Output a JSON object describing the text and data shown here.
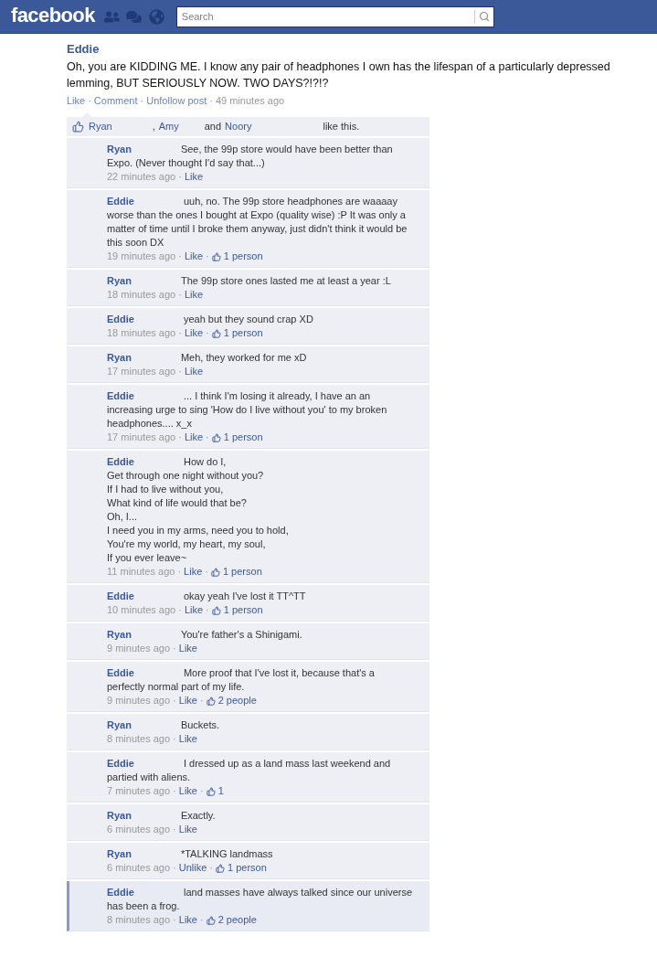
{
  "header": {
    "logo": "facebook",
    "search": {
      "placeholder": "Search"
    }
  },
  "post": {
    "author": "Eddie",
    "message": "Oh, you are KIDDING ME. I know any pair of headphones I own has the lifespan of a particularly depressed lemming, BUT SERIOUSLY NOW. TWO DAYS?!?!?",
    "footer": [
      {
        "kind": "link",
        "text": "Like"
      },
      {
        "kind": "sep",
        "text": "·"
      },
      {
        "kind": "link",
        "text": "Comment"
      },
      {
        "kind": "sep",
        "text": "·"
      },
      {
        "kind": "link",
        "text": "Unfollow post"
      },
      {
        "kind": "sep",
        "text": "·"
      },
      {
        "kind": "time",
        "text": "49 minutes ago"
      }
    ]
  },
  "likes": {
    "parts": [
      {
        "kind": "name",
        "text": "Ryan"
      },
      {
        "kind": "plain",
        "text": ","
      },
      {
        "kind": "name",
        "text": "Amy"
      },
      {
        "kind": "plain",
        "text": "and"
      },
      {
        "kind": "name",
        "text": "Noory"
      },
      {
        "kind": "plain",
        "text": "like this."
      }
    ]
  },
  "comments": [
    {
      "author": "Ryan",
      "text": "See, the 99p store would have been better than Expo. (Never thought I'd say that...)",
      "highlighted": false,
      "footer": [
        {
          "kind": "time",
          "text": "22 minutes ago"
        },
        {
          "kind": "sep",
          "text": "·"
        },
        {
          "kind": "link",
          "text": "Like"
        }
      ]
    },
    {
      "author": "Eddie",
      "text": "uuh, no. The 99p store headphones are waaaay worse than the ones I bought at Expo (quality wise) :P It was only a matter of time until I broke them anyway, just didn't think it would be this soon DX",
      "highlighted": false,
      "footer": [
        {
          "kind": "time",
          "text": "19 minutes ago"
        },
        {
          "kind": "sep",
          "text": "·"
        },
        {
          "kind": "link",
          "text": "Like"
        },
        {
          "kind": "sep",
          "text": "·"
        },
        {
          "kind": "likes",
          "text": "1 person"
        }
      ]
    },
    {
      "author": "Ryan",
      "text": "The 99p store ones lasted me at least a year :L",
      "highlighted": false,
      "footer": [
        {
          "kind": "time",
          "text": "18 minutes ago"
        },
        {
          "kind": "sep",
          "text": "·"
        },
        {
          "kind": "link",
          "text": "Like"
        }
      ]
    },
    {
      "author": "Eddie",
      "text": "yeah but they sound crap XD",
      "highlighted": false,
      "footer": [
        {
          "kind": "time",
          "text": "18 minutes ago"
        },
        {
          "kind": "sep",
          "text": "·"
        },
        {
          "kind": "link",
          "text": "Like"
        },
        {
          "kind": "sep",
          "text": "·"
        },
        {
          "kind": "likes",
          "text": "1 person"
        }
      ]
    },
    {
      "author": "Ryan",
      "text": "Meh, they worked for me xD",
      "highlighted": false,
      "footer": [
        {
          "kind": "time",
          "text": "17 minutes ago"
        },
        {
          "kind": "sep",
          "text": "·"
        },
        {
          "kind": "link",
          "text": "Like"
        }
      ]
    },
    {
      "author": "Eddie",
      "text": "... I think I'm losing it already, I have an an increasing urge to sing 'How do I live without you' to my broken headphones.... x_x",
      "highlighted": false,
      "footer": [
        {
          "kind": "time",
          "text": "17 minutes ago"
        },
        {
          "kind": "sep",
          "text": "·"
        },
        {
          "kind": "link",
          "text": "Like"
        },
        {
          "kind": "sep",
          "text": "·"
        },
        {
          "kind": "likes",
          "text": "1 person"
        }
      ]
    },
    {
      "author": "Eddie",
      "text": "How do I,\nGet through one night without you?\nIf I had to live without you,\nWhat kind of life would that be?\nOh, I...\nI need you in my arms, need you to hold,\nYou're my world, my heart, my soul,\nIf you ever leave~",
      "highlighted": false,
      "footer": [
        {
          "kind": "time",
          "text": "11 minutes ago"
        },
        {
          "kind": "sep",
          "text": "·"
        },
        {
          "kind": "link",
          "text": "Like"
        },
        {
          "kind": "sep",
          "text": "·"
        },
        {
          "kind": "likes",
          "text": "1 person"
        }
      ]
    },
    {
      "author": "Eddie",
      "text": "okay yeah I've lost it TT^TT",
      "highlighted": false,
      "footer": [
        {
          "kind": "time",
          "text": "10 minutes ago"
        },
        {
          "kind": "sep",
          "text": "·"
        },
        {
          "kind": "link",
          "text": "Like"
        },
        {
          "kind": "sep",
          "text": "·"
        },
        {
          "kind": "likes",
          "text": "1 person"
        }
      ]
    },
    {
      "author": "Ryan",
      "text": "You're father's a Shinigami.",
      "highlighted": false,
      "footer": [
        {
          "kind": "time",
          "text": "9 minutes ago"
        },
        {
          "kind": "sep",
          "text": "·"
        },
        {
          "kind": "link",
          "text": "Like"
        }
      ]
    },
    {
      "author": "Eddie",
      "text": "More proof that I've lost it, because that's a perfectly normal part of my life.",
      "highlighted": false,
      "footer": [
        {
          "kind": "time",
          "text": "9 minutes ago"
        },
        {
          "kind": "sep",
          "text": "·"
        },
        {
          "kind": "link",
          "text": "Like"
        },
        {
          "kind": "sep",
          "text": "·"
        },
        {
          "kind": "likes",
          "text": "2 people"
        }
      ]
    },
    {
      "author": "Ryan",
      "text": "Buckets.",
      "highlighted": false,
      "footer": [
        {
          "kind": "time",
          "text": "8 minutes ago"
        },
        {
          "kind": "sep",
          "text": "·"
        },
        {
          "kind": "link",
          "text": "Like"
        }
      ]
    },
    {
      "author": "Eddie",
      "text": "I dressed up as a land mass last weekend and partied with aliens.",
      "highlighted": false,
      "footer": [
        {
          "kind": "time",
          "text": "7 minutes ago"
        },
        {
          "kind": "sep",
          "text": "·"
        },
        {
          "kind": "link",
          "text": "Like"
        },
        {
          "kind": "sep",
          "text": "·"
        },
        {
          "kind": "likes",
          "text": "1"
        }
      ]
    },
    {
      "author": "Ryan",
      "text": "Exactly.",
      "highlighted": false,
      "footer": [
        {
          "kind": "time",
          "text": "6 minutes ago"
        },
        {
          "kind": "sep",
          "text": "·"
        },
        {
          "kind": "link",
          "text": "Like"
        }
      ]
    },
    {
      "author": "Ryan",
      "text": "*TALKING landmass",
      "highlighted": false,
      "footer": [
        {
          "kind": "time",
          "text": "6 minutes ago"
        },
        {
          "kind": "sep",
          "text": "·"
        },
        {
          "kind": "link",
          "text": "Unlike"
        },
        {
          "kind": "sep",
          "text": "·"
        },
        {
          "kind": "likes",
          "text": "1 person"
        }
      ]
    },
    {
      "author": "Eddie",
      "text": "land masses have always talked since our universe has been a frog.",
      "highlighted": true,
      "footer": [
        {
          "kind": "time",
          "text": "8 minutes ago"
        },
        {
          "kind": "sep",
          "text": "·"
        },
        {
          "kind": "link",
          "text": "Like"
        },
        {
          "kind": "sep",
          "text": "·"
        },
        {
          "kind": "likes",
          "text": "2 people"
        }
      ]
    }
  ]
}
